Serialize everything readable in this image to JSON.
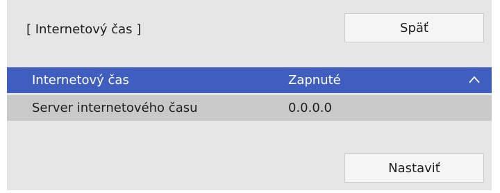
{
  "header": {
    "breadcrumb": "[ Internetový čas ]",
    "back_label": "Späť"
  },
  "settings": {
    "rows": [
      {
        "label": "Internetový čas",
        "value": "Zapnuté",
        "selected": true,
        "icon": "chevron-up-icon"
      },
      {
        "label": "Server internetového času",
        "value": "0.0.0.0",
        "selected": false
      }
    ]
  },
  "footer": {
    "set_label": "Nastaviť"
  },
  "colors": {
    "panel_bg": "#e6e6e6",
    "selected_row_bg": "#3f5ebf",
    "row_bg": "#c9c9c9",
    "button_bg": "#f5f5f5"
  }
}
